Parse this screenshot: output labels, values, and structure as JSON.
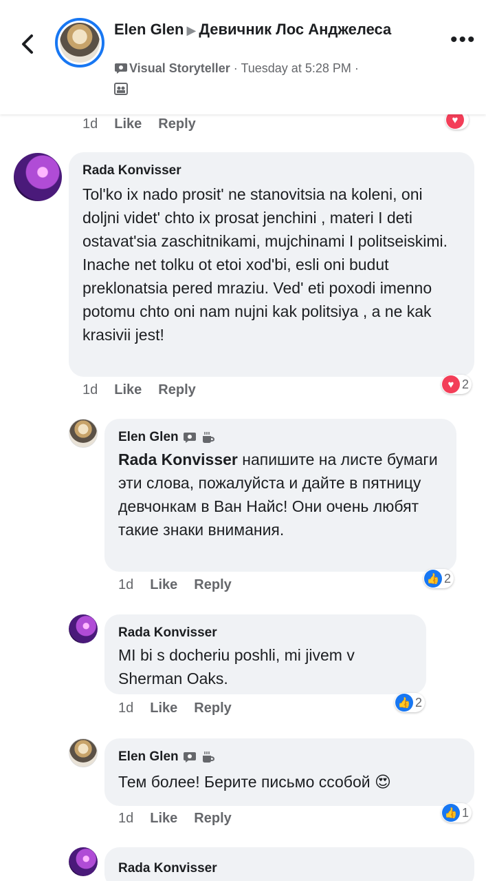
{
  "header": {
    "author": "Elen Glen",
    "group": "Девичник Лос Анджелеса",
    "badge": "Visual Storyteller",
    "time": "Tuesday at 5:28 PM",
    "dot": "·"
  },
  "top_actions": {
    "time": "1d",
    "like": "Like",
    "reply": "Reply"
  },
  "comments": [
    {
      "author": "Rada Konvisser",
      "text": "Tol'ko ix nado prosit' ne stanovitsia na koleni, oni doljni videt' chto ix prosat jenchini , materi I deti ostavat'sia zaschitnikami, mujchinami I politseiskimi. Inache net tolku ot etoi xod'bi, esli oni budut preklonatsia pered mraziu. Ved' eti poxodi imenno potomu chto oni nam nujni kak politsiya , a ne kak krasivii jest!",
      "time": "1d",
      "like": "Like",
      "reply": "Reply",
      "reaction": "love",
      "reaction_count": "2"
    },
    {
      "author": "Elen Glen",
      "mention": "Rada Konvisser",
      "text": " напишите на листе бумаги эти слова, пожалуйста  и дайте в пятницу девчонкам в Ван Найс! Они очень любят такие знаки внимания.",
      "time": "1d",
      "like": "Like",
      "reply": "Reply",
      "reaction": "like",
      "reaction_count": "2"
    },
    {
      "author": "Rada Konvisser",
      "text": "MI bi  s docheriu poshli, mi jivem v Sherman Oaks.",
      "time": "1d",
      "like": "Like",
      "reply": "Reply",
      "reaction": "like",
      "reaction_count": "2"
    },
    {
      "author": "Elen Glen",
      "text": "Тем более! Берите письмо ссобой 😍",
      "time": "1d",
      "like": "Like",
      "reply": "Reply",
      "reaction": "like",
      "reaction_count": "1"
    },
    {
      "author": "Rada Konvisser"
    }
  ],
  "colors": {
    "accent": "#1877f2",
    "love": "#f33e58",
    "bubble": "#f0f2f5",
    "secondary_text": "#65676b"
  }
}
